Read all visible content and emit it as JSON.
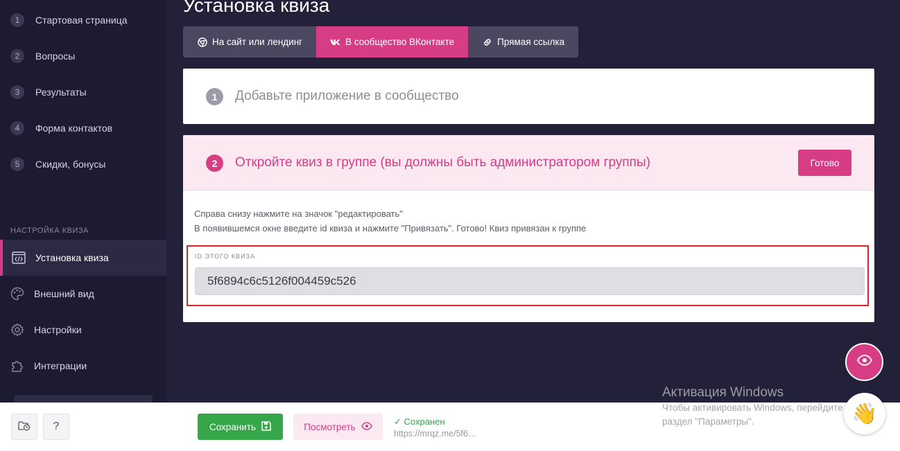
{
  "sidebar": {
    "steps": [
      {
        "num": "1",
        "label": "Стартовая страница"
      },
      {
        "num": "2",
        "label": "Вопросы"
      },
      {
        "num": "3",
        "label": "Результаты"
      },
      {
        "num": "4",
        "label": "Форма контактов"
      },
      {
        "num": "5",
        "label": "Скидки, бонусы"
      }
    ],
    "section_title": "НАСТРОЙКА КВИЗА",
    "nav": [
      {
        "label": "Установка квиза",
        "icon": "code-icon",
        "active": true
      },
      {
        "label": "Внешний вид",
        "icon": "palette-icon"
      },
      {
        "label": "Настройки",
        "icon": "gear-icon"
      },
      {
        "label": "Интеграции",
        "icon": "puzzle-icon"
      }
    ]
  },
  "main": {
    "title": "Установка квиза",
    "tabs": [
      {
        "label": "На сайт или лендинг",
        "icon": "chrome-icon"
      },
      {
        "label": "В сообщество ВКонтакте",
        "icon": "vk-icon",
        "active": true
      },
      {
        "label": "Прямая ссылка",
        "icon": "link-icon"
      }
    ],
    "step1": {
      "num": "1",
      "title": "Добавьте приложение в сообщество"
    },
    "step2": {
      "num": "2",
      "title": "Откройте квиз в группе (вы должны быть администратором группы)",
      "done_label": "Готово",
      "instructions": [
        "Справа снизу нажмите на значок \"редактировать\"",
        "В появившемся окне введите id квиза и нажмите \"Привязать\". Готово! Квиз привязан к группе"
      ],
      "id_label": "ID ЭТОГО КВИЗА",
      "id_value": "5f6894c6c5126f004459c526"
    }
  },
  "footer": {
    "help_label": "?",
    "save_label": "Сохранить",
    "view_label": "Посмотреть",
    "saved_status": "✓ Сохранен",
    "saved_url": "https://mrqz.me/5f6…"
  },
  "windows_watermark": {
    "title": "Активация Windows",
    "line1": "Чтобы активировать Windows, перейдите в",
    "line2": "раздел \"Параметры\"."
  },
  "colors": {
    "accent": "#d63d85",
    "sidebar_bg": "#1d1b32",
    "main_bg": "#23213a",
    "save_green": "#35a74a",
    "highlight_red": "#d9232d"
  }
}
